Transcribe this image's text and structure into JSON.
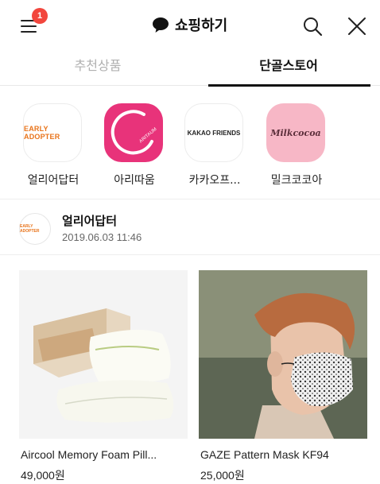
{
  "header": {
    "menu_icon": "hamburger-menu-icon",
    "notification_count": "1",
    "title": "쇼핑하기",
    "title_icon": "chat-bubble-icon",
    "search_icon": "search-icon",
    "close_icon": "close-icon"
  },
  "tabs": [
    {
      "label": "추천상품",
      "active": false
    },
    {
      "label": "단골스토어",
      "active": true
    }
  ],
  "stores": [
    {
      "name": "얼리어답터",
      "logo_text": "EARLY ADOPTER",
      "logo_color": "#e8731a"
    },
    {
      "name": "아리따움",
      "logo_text": "ARITAUM",
      "logo_color": "#e8337a"
    },
    {
      "name": "카카오프...",
      "logo_text": "KAKAO FRIENDS",
      "logo_color": "#222222"
    },
    {
      "name": "밀크코코아",
      "logo_text": "Milkcocoa",
      "logo_color": "#f7b7c6"
    }
  ],
  "post": {
    "store_name": "얼리어답터",
    "avatar_text": "EARLY ADOPTER",
    "date": "2019.06.03 11:46"
  },
  "products": [
    {
      "name": "Aircool Memory Foam Pill...",
      "price": "49,000원"
    },
    {
      "name": "GAZE Pattern Mask KF94",
      "price": "25,000원"
    }
  ],
  "colors": {
    "badge": "#f2463d",
    "aritaum": "#e8337a",
    "milkcocoa": "#f7b7c6",
    "early_adopter": "#e8731a"
  }
}
